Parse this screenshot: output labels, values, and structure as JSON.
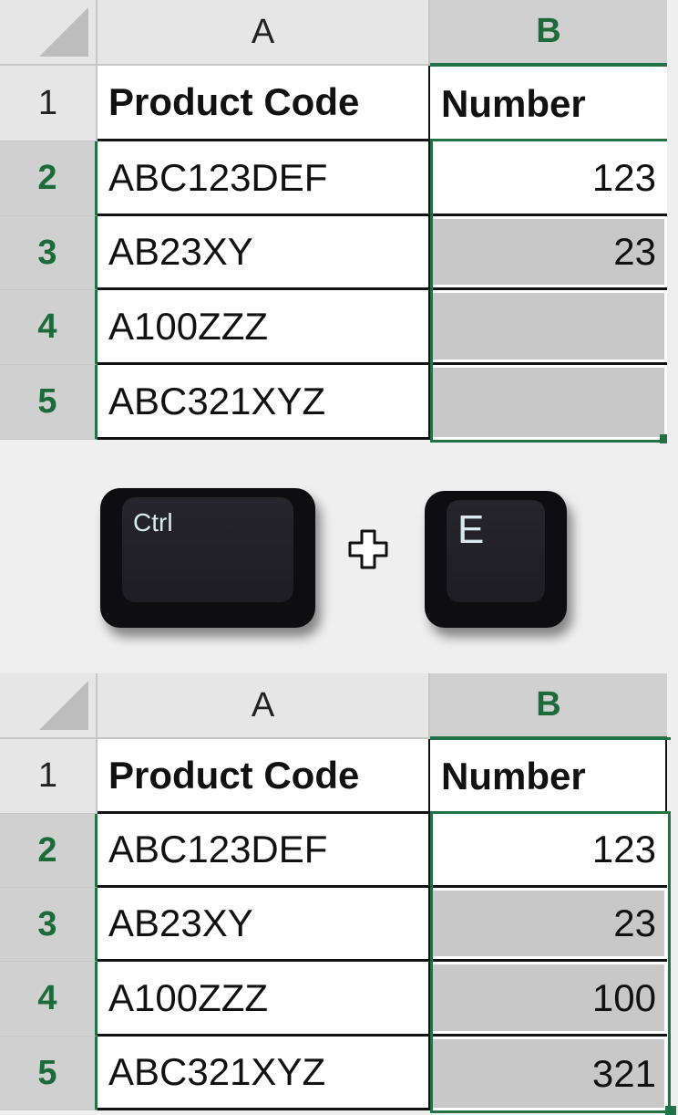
{
  "top_sheet": {
    "columns": [
      "A",
      "B"
    ],
    "rows": [
      {
        "num": "1",
        "a": "Product Code",
        "b": "Number"
      },
      {
        "num": "2",
        "a": "ABC123DEF",
        "b": "123"
      },
      {
        "num": "3",
        "a": "AB23XY",
        "b": "23"
      },
      {
        "num": "4",
        "a": "A100ZZZ",
        "b": ""
      },
      {
        "num": "5",
        "a": "ABC321XYZ",
        "b": ""
      }
    ]
  },
  "shortcut": {
    "key1": "Ctrl",
    "separator_icon": "plus-icon",
    "key2": "E"
  },
  "bottom_sheet": {
    "columns": [
      "A",
      "B"
    ],
    "rows": [
      {
        "num": "1",
        "a": "Product Code",
        "b": "Number"
      },
      {
        "num": "2",
        "a": "ABC123DEF",
        "b": "123"
      },
      {
        "num": "3",
        "a": "AB23XY",
        "b": "23"
      },
      {
        "num": "4",
        "a": "A100ZZZ",
        "b": "100"
      },
      {
        "num": "5",
        "a": "ABC321XYZ",
        "b": "321"
      }
    ]
  },
  "colors": {
    "selection_accent": "#217346",
    "selected_header_text": "#1e6b3a",
    "shaded_cell": "#c8c8c8"
  }
}
